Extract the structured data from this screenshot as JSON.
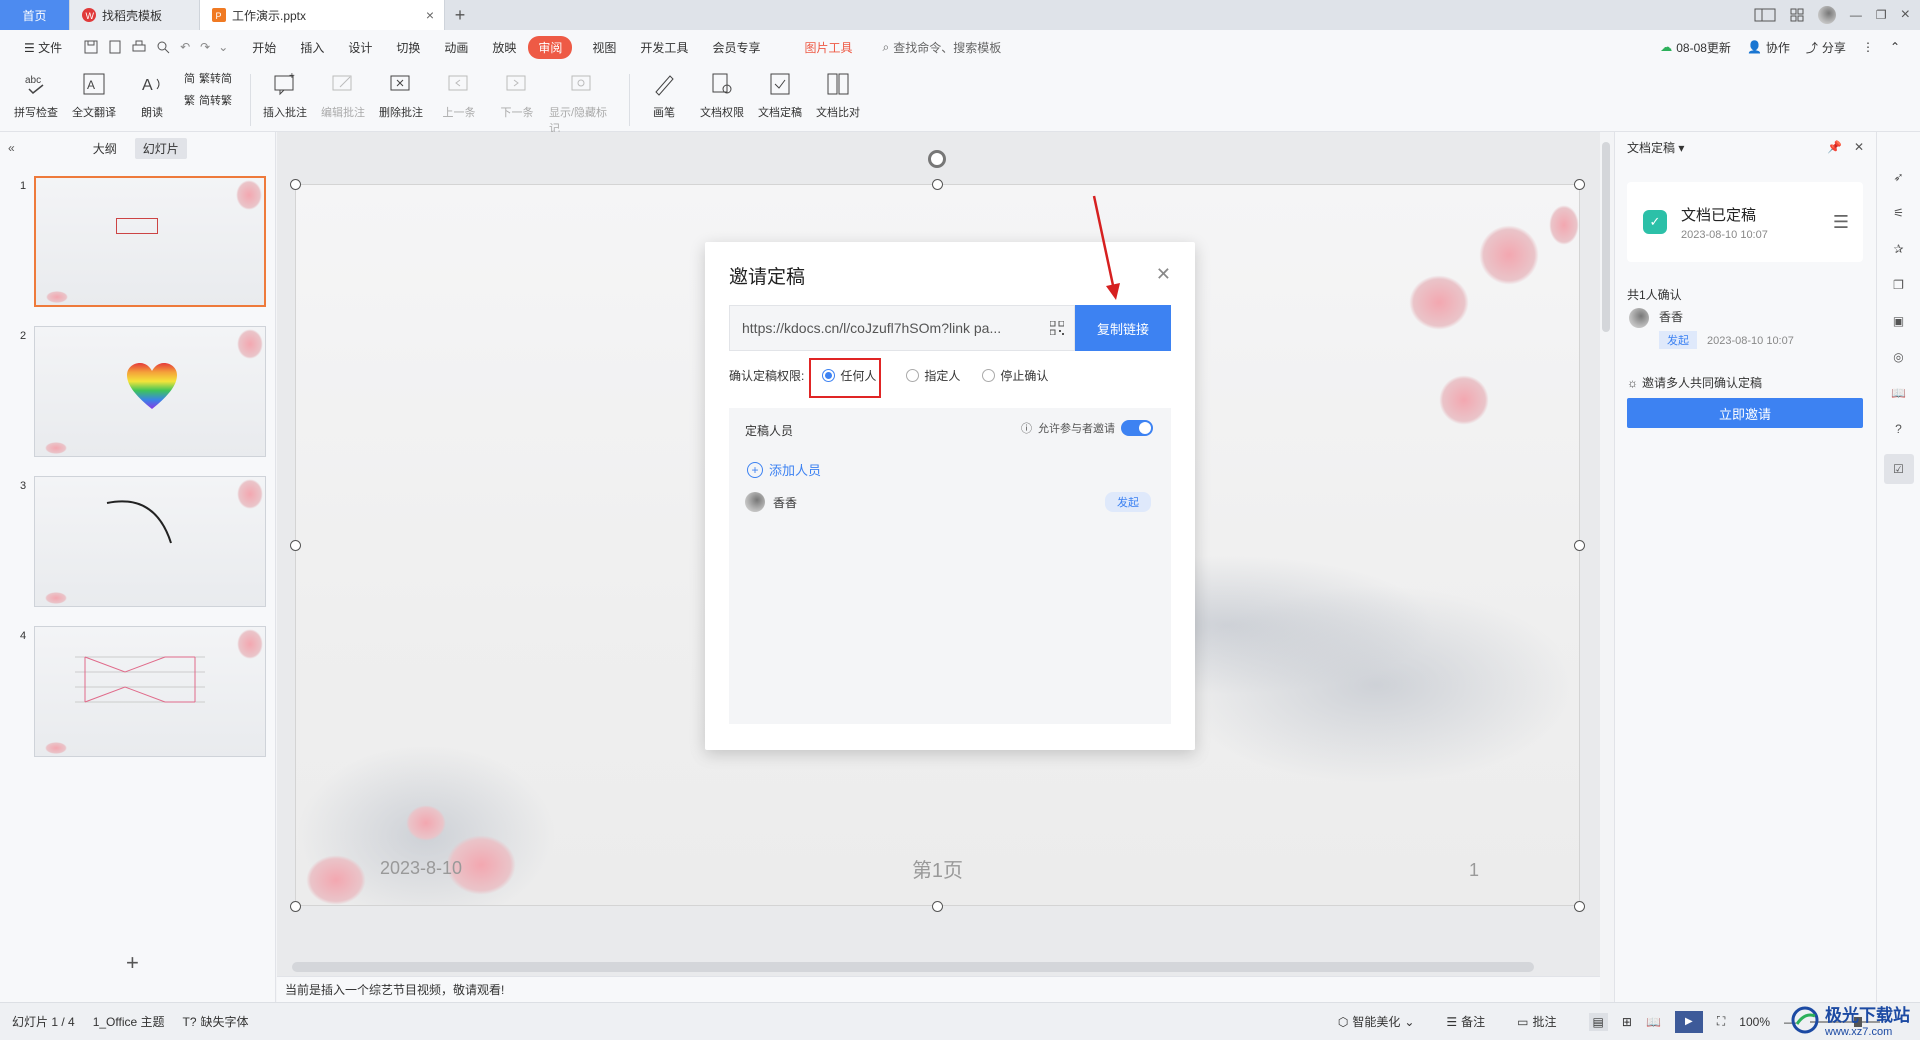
{
  "titlebar": {
    "home": "首页",
    "tabs": [
      {
        "label": "找稻壳模板"
      },
      {
        "label": "工作演示.pptx"
      }
    ]
  },
  "menubar": {
    "file": "文件",
    "items": [
      "开始",
      "插入",
      "设计",
      "切换",
      "动画",
      "放映",
      "审阅",
      "视图",
      "开发工具",
      "会员专享"
    ],
    "active": "审阅",
    "picture_tools": "图片工具",
    "search": "查找命令、搜索模板",
    "update": "08-08更新",
    "collab": "协作",
    "share": "分享"
  },
  "ribbon": {
    "spell": "拼写检查",
    "translate": "全文翻译",
    "read": "朗读",
    "trad_to_simp": "繁转简",
    "simp_to_trad": "简转繁",
    "insert_comment": "插入批注",
    "edit_comment": "编辑批注",
    "delete_comment": "删除批注",
    "prev": "上一条",
    "next": "下一条",
    "show_hide": "显示/隐藏标记",
    "pen": "画笔",
    "doc_rights": "文档权限",
    "doc_finalize": "文档定稿",
    "doc_compare": "文档比对"
  },
  "leftpane": {
    "tab_outline": "大纲",
    "tab_slides": "幻灯片",
    "slides": [
      {
        "num": "1"
      },
      {
        "num": "2"
      },
      {
        "num": "3"
      },
      {
        "num": "4"
      }
    ]
  },
  "slide": {
    "date": "2023-8-10",
    "page": "第1页",
    "number": "1"
  },
  "dialog": {
    "title": "邀请定稿",
    "link": "https://kdocs.cn/l/coJzufl7hSOm?link pa...",
    "copy": "复制链接",
    "perm_label": "确认定稿权限:",
    "opt_anyone": "任何人",
    "opt_specified": "指定人",
    "opt_stop": "停止确认",
    "people_title": "定稿人员",
    "allow_invite": "允许参与者邀请",
    "add_person": "添加人员",
    "person_name": "香香",
    "person_badge": "发起"
  },
  "rightpane": {
    "title": "文档定稿",
    "card_title": "文档已定稿",
    "card_time": "2023-08-10 10:07",
    "count": "共1人确认",
    "person": "香香",
    "badge": "发起",
    "time": "2023-08-10 10:07",
    "invite_text": "邀请多人共同确认定稿",
    "invite_btn": "立即邀请"
  },
  "notes": {
    "text": "当前是插入一个综艺节目视频，敬请观看!"
  },
  "status": {
    "slide": "幻灯片 1 / 4",
    "theme": "1_Office 主题",
    "missing_font": "缺失字体",
    "smart": "智能美化",
    "notes": "备注",
    "comment": "批注",
    "zoom": "100%"
  },
  "watermark": {
    "brand": "极光下载站",
    "url": "www.xz7.com"
  },
  "colors": {
    "accent": "#3d82f2",
    "review_active": "#ee5a45",
    "highlight": "#e02525"
  }
}
